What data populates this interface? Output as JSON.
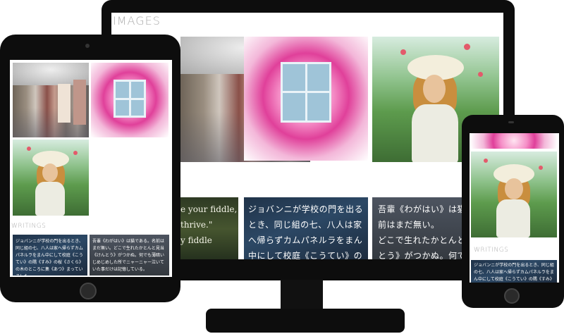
{
  "section_images": "IMAGES",
  "section_writings": "WRITINGS",
  "writing_en": {
    "line1": "e your fiddle,",
    "line2": "thrive.\"",
    "line3": "y fiddle"
  },
  "writing_jp_monitor": {
    "line1": "ジョバンニが学校の門を出るとき、同じ組の七、八人は家へ帰らずカムパネルラをまん中にして校庭《こうてい》の隅《すみ》の桜《さくら》の木のところに集《あつ》ま"
  },
  "writing_cat_monitor": {
    "line1": "吾輩《わがはい》は猫で",
    "line2": "前はまだ無い。",
    "line3": "どこで生れたかとんと見",
    "line4": "とう》がつかぬ。何でも薄"
  },
  "writing_jp_tablet": "ジョバンニが学校の門を出るとき、同じ組の七、八人は家へ帰らずカムパネルラをまん中にして校庭《こうてい》の隅《すみ》の桜《さくら》の木のところに集《あつ》まっていました。",
  "writing_cat_tablet": "吾輩《わがはい》は猫である。名前はまだ無い。どこで生れたかとんと見当《けんとう》がつかぬ。何でも薄暗いじめじめした所でニャーニャー泣いていた事だけは記憶している。",
  "writing_jp_phone": "ジョバンニが学校の門を出るとき、同じ組の七、八人は家へ帰らずカムパネルラをまん中にして校庭《こうてい》の隅《すみ》の桜"
}
